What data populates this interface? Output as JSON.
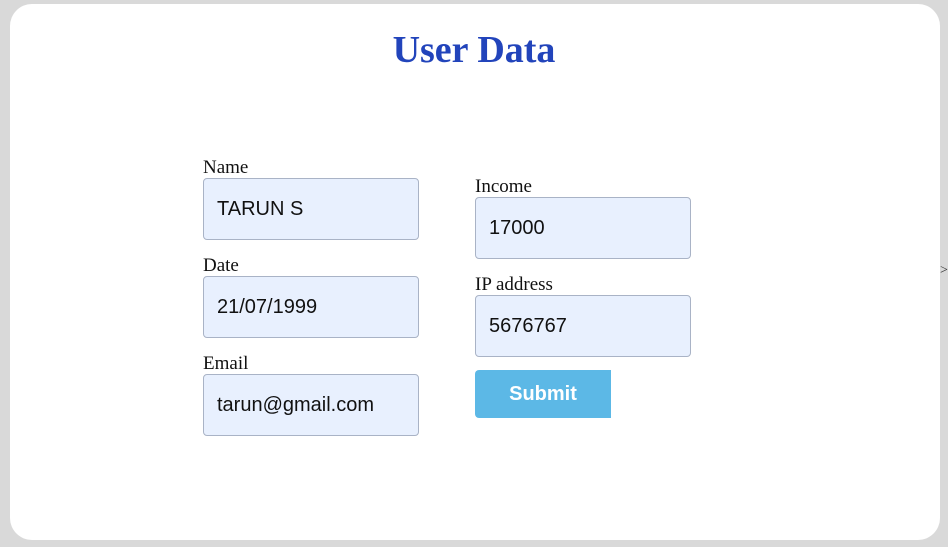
{
  "title": "User Data",
  "fields": {
    "name": {
      "label": "Name",
      "value": "TARUN S"
    },
    "date": {
      "label": "Date",
      "value": "21/07/1999"
    },
    "email": {
      "label": "Email",
      "value": "tarun@gmail.com"
    },
    "income": {
      "label": "Income",
      "value": "17000"
    },
    "ip": {
      "label": "IP address",
      "value": "5676767"
    }
  },
  "submit_label": "Submit",
  "edge_glyph": ">",
  "colors": {
    "background": "#d9d9d9",
    "card": "#ffffff",
    "title": "#2244bb",
    "input_bg": "#e8f0fe",
    "input_border": "#a9b3c6",
    "button": "#5cb8e6",
    "button_text": "#ffffff"
  }
}
